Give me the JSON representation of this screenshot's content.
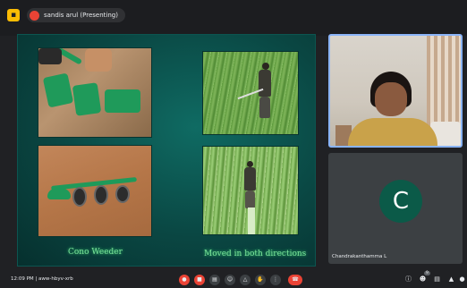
{
  "presenter_chip": {
    "text": "sandis arul (Presenting)"
  },
  "slide": {
    "caption_left": "Cono Weeder",
    "caption_right": "Moved in both directions"
  },
  "participant": {
    "avatar_letter": "C",
    "name": "Chandrakanthamma L"
  },
  "bottom_bar": {
    "time": "12:09 PM",
    "separator": "|",
    "meeting_code": "aww-hbyv-xrb",
    "people_count": "9"
  },
  "controls": {
    "mic_icon": "mic-off-icon",
    "camera_icon": "camera-off-icon",
    "captions_icon": "captions-icon",
    "emoji_icon": "emoji-icon",
    "present_icon": "present-icon",
    "raise_hand_icon": "raise-hand-icon",
    "more_icon": "more-icon",
    "leave_icon": "end-call-icon"
  },
  "colors": {
    "accent_red": "#ea4335",
    "slide_bg": "#0a4743",
    "avatar_bg": "#0b5a48",
    "caption_green": "#7be49a"
  }
}
